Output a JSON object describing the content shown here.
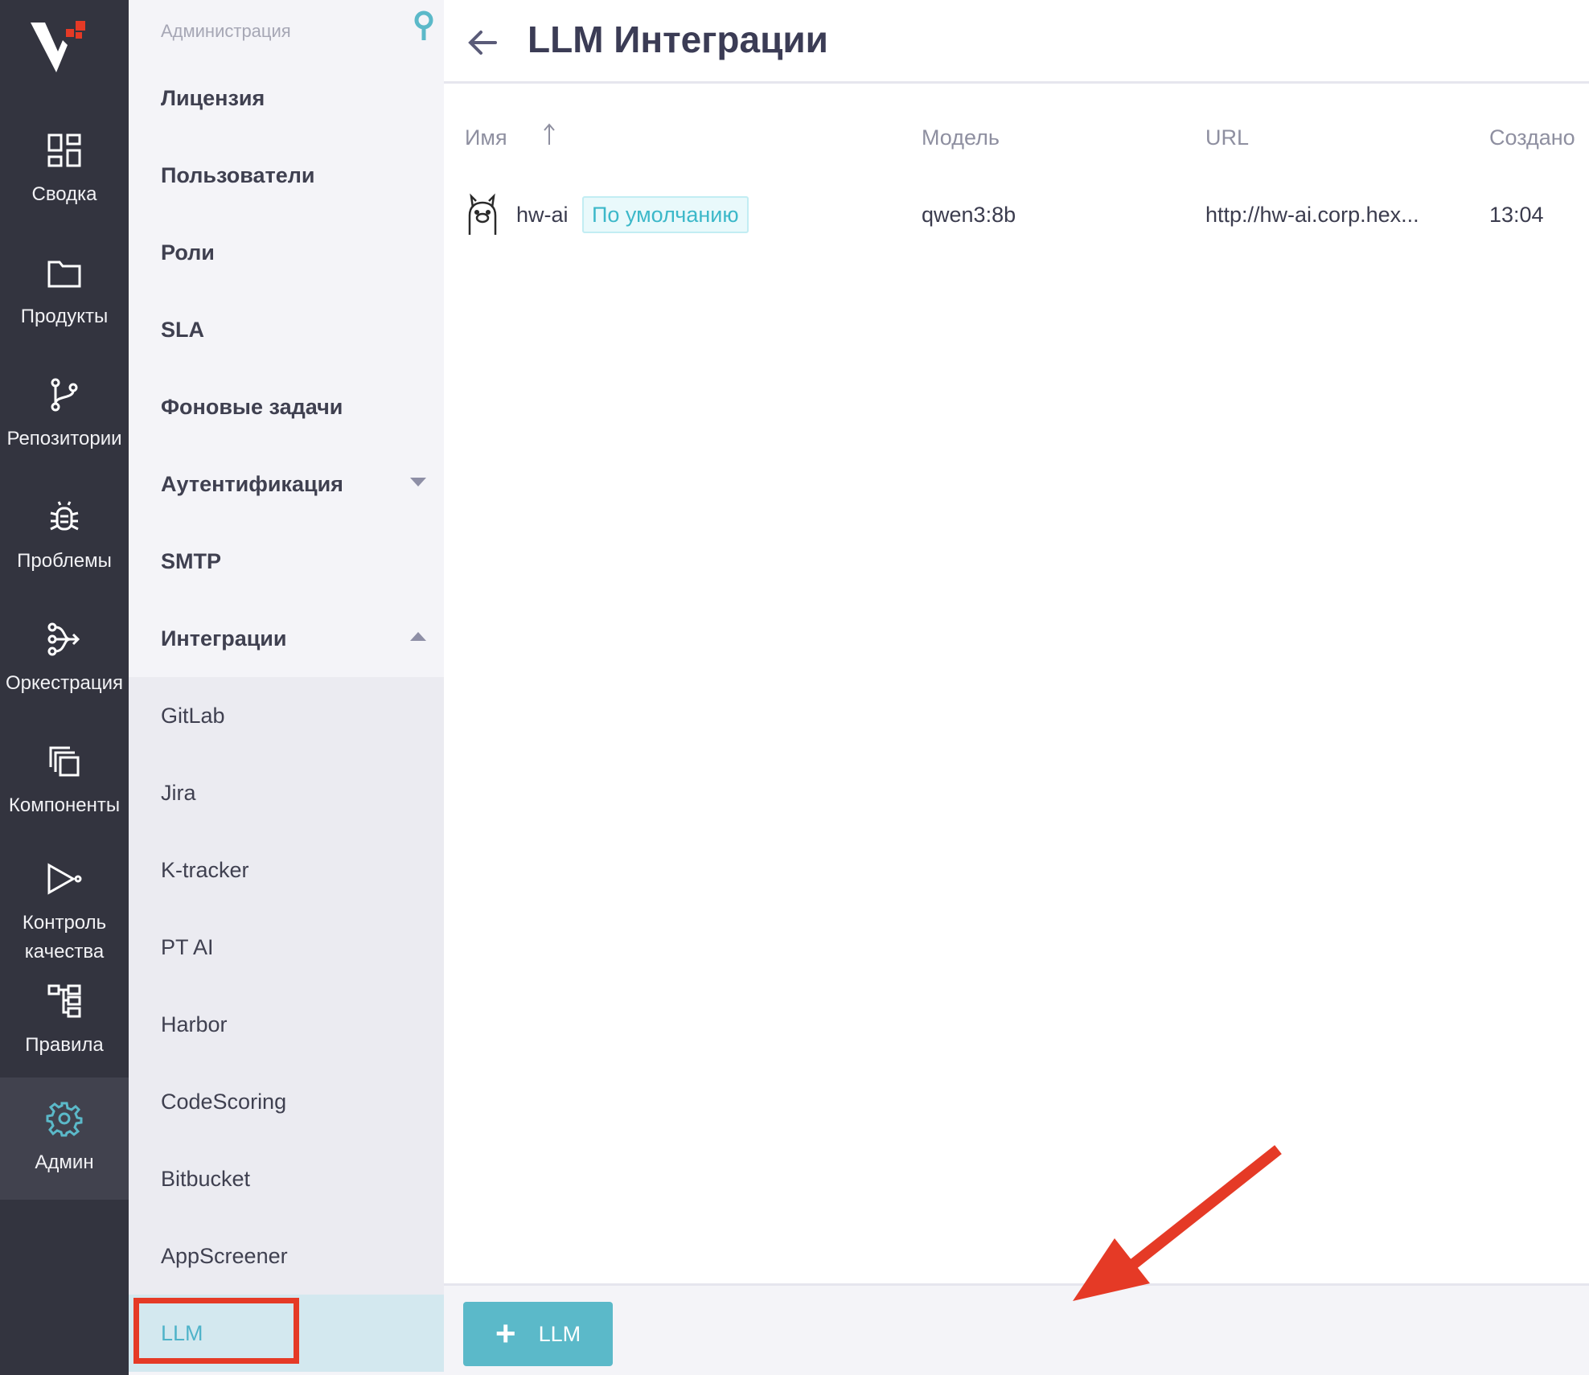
{
  "rail": {
    "items": [
      {
        "label": "Сводка",
        "icon": "dashboard-icon"
      },
      {
        "label": "Продукты",
        "icon": "folder-icon"
      },
      {
        "label": "Репозитории",
        "icon": "git-branch-icon"
      },
      {
        "label": "Проблемы",
        "icon": "bug-icon"
      },
      {
        "label": "Оркестрация",
        "icon": "orchestration-icon"
      },
      {
        "label": "Компоненты",
        "icon": "components-icon"
      },
      {
        "label": "Контроль\nкачества",
        "icon": "quality-gate-icon"
      },
      {
        "label": "Правила",
        "icon": "rules-icon"
      },
      {
        "label": "Админ",
        "icon": "gear-icon",
        "active": true
      }
    ]
  },
  "submenu": {
    "group_title": "Администрация",
    "items": {
      "license": "Лицензия",
      "users": "Пользователи",
      "roles": "Роли",
      "sla": "SLA",
      "background_tasks": "Фоновые задачи",
      "authentication": "Аутентификация",
      "smtp": "SMTP",
      "integrations": "Интеграции",
      "gitlab": "GitLab",
      "jira": "Jira",
      "ktracker": "K-tracker",
      "ptai": "PT AI",
      "harbor": "Harbor",
      "codescoring": "CodeScoring",
      "bitbucket": "Bitbucket",
      "appscreener": "AppScreener",
      "llm": "LLM"
    }
  },
  "main": {
    "title": "LLM Интеграции",
    "columns": {
      "name": "Имя",
      "model": "Модель",
      "url": "URL",
      "created": "Создано"
    },
    "rows": [
      {
        "name": "hw-ai",
        "badge": "По умолчанию",
        "model": "qwen3:8b",
        "url": "http://hw-ai.corp.hex...",
        "created": "13:04"
      }
    ],
    "add_button_label": "LLM"
  },
  "colors": {
    "rail_bg": "#33343f",
    "submenu_bg": "#f4f4f8",
    "accent": "#5bb9c9",
    "annotation": "#e53a26"
  }
}
